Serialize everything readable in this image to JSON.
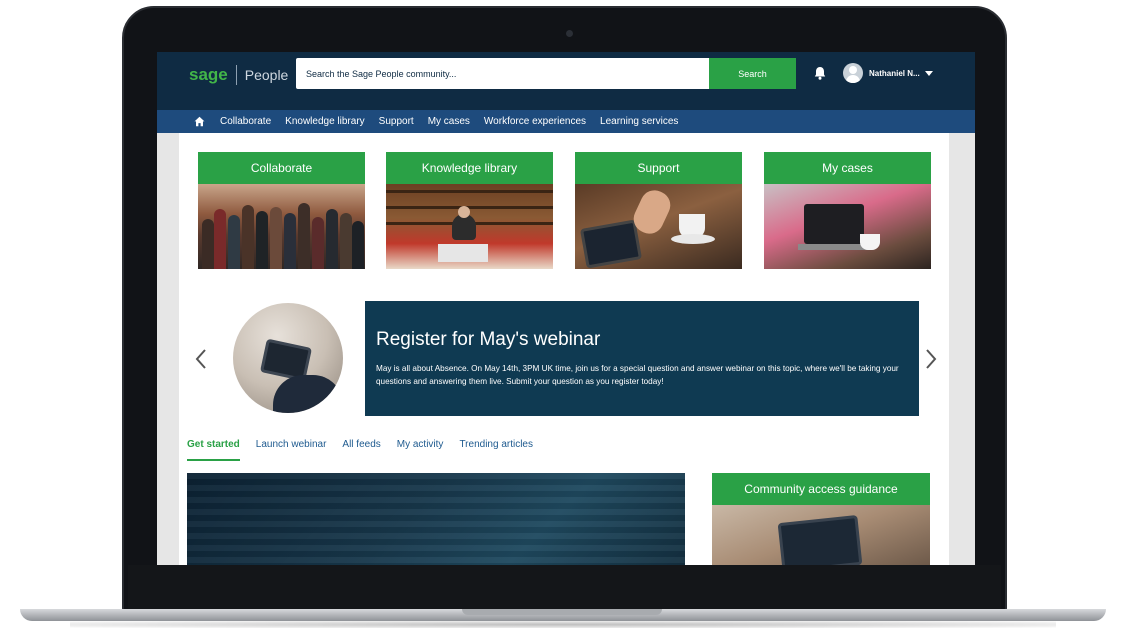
{
  "header": {
    "logo_brand": "sage",
    "logo_product": "People",
    "search_placeholder": "Search the Sage People community...",
    "search_button": "Search",
    "user_name": "Nathaniel N...",
    "icons": [
      "bell-icon",
      "avatar",
      "chevron-down-icon"
    ]
  },
  "nav": {
    "items": [
      {
        "label": "Collaborate"
      },
      {
        "label": "Knowledge library"
      },
      {
        "label": "Support"
      },
      {
        "label": "My cases"
      },
      {
        "label": "Workforce experiences"
      },
      {
        "label": "Learning services"
      }
    ]
  },
  "tiles": [
    {
      "label": "Collaborate"
    },
    {
      "label": "Knowledge library"
    },
    {
      "label": "Support"
    },
    {
      "label": "My cases"
    }
  ],
  "banner": {
    "title": "Register for May's webinar",
    "text": "May is all about Absence. On May 14th, 3PM UK time, join us for a special question and answer webinar on this topic, where we'll be taking your questions and answering them live. Submit your question as you register today!"
  },
  "tabs": [
    {
      "label": "Get started",
      "active": true
    },
    {
      "label": "Launch webinar"
    },
    {
      "label": "All feeds"
    },
    {
      "label": "My activity"
    },
    {
      "label": "Trending articles"
    }
  ],
  "guidance": {
    "title": "Community access guidance"
  },
  "colors": {
    "header_bg": "#0f2b43",
    "nav_bg": "#1e4b7d",
    "accent_green": "#2aa146",
    "banner_bg": "#0f3a52",
    "link_blue": "#1e5a8f"
  }
}
